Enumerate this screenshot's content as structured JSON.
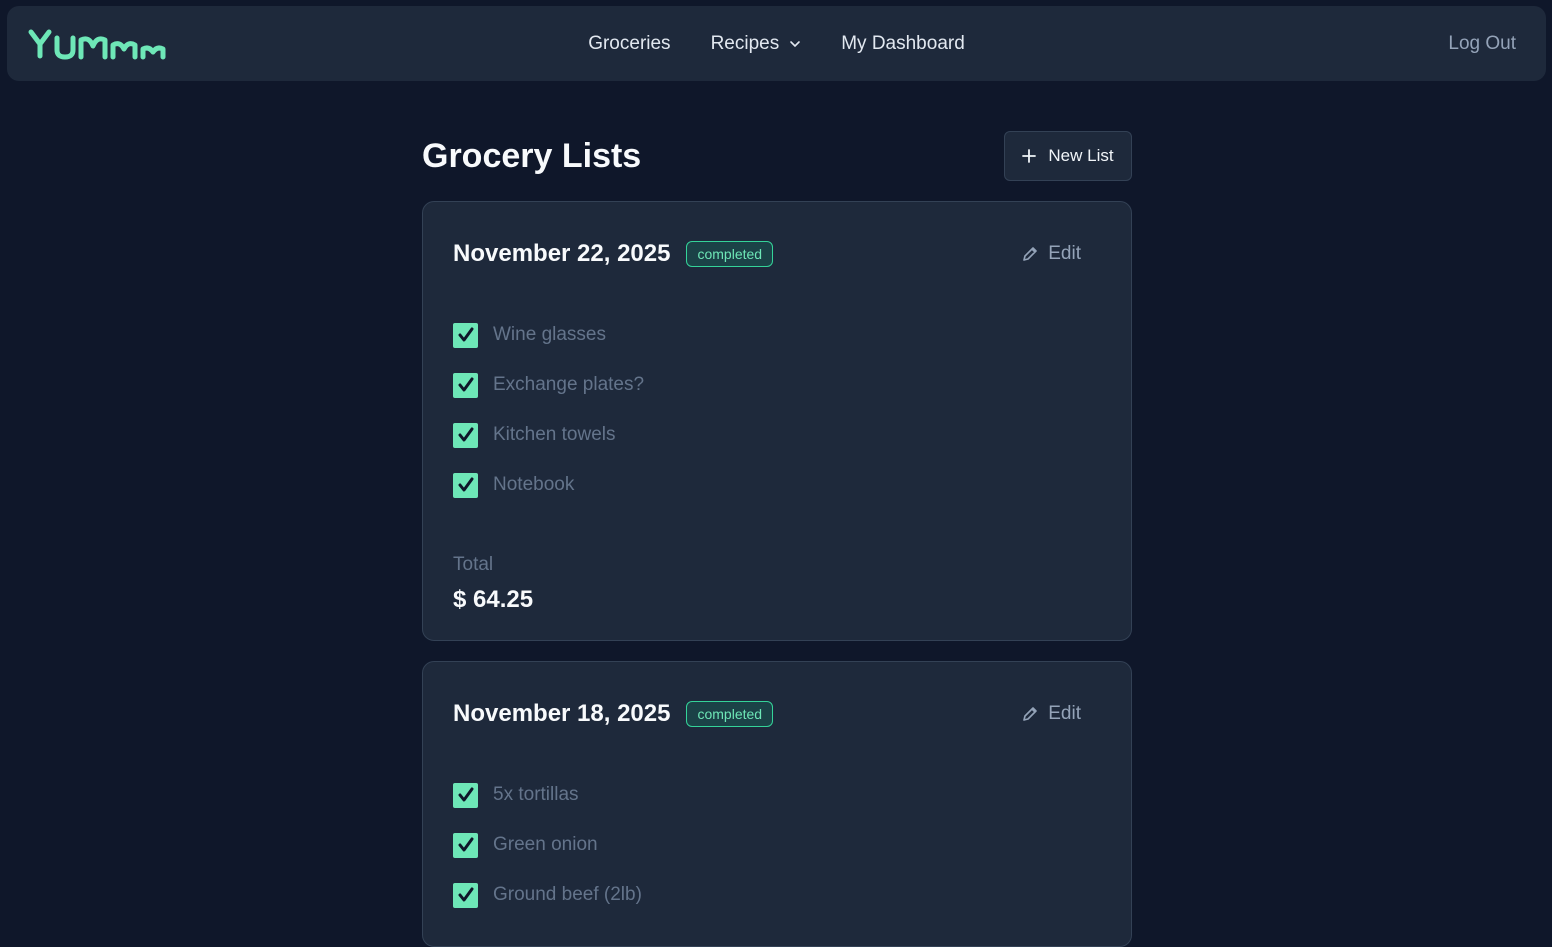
{
  "nav": {
    "logo_text": "YUMMM",
    "links": [
      {
        "label": "Groceries"
      },
      {
        "label": "Recipes"
      },
      {
        "label": "My Dashboard"
      }
    ],
    "logout": "Log Out"
  },
  "colors": {
    "accent": "#6ee7b7",
    "background": "#0f172a",
    "surface": "#1e293b"
  },
  "page": {
    "title": "Grocery Lists",
    "new_list_label": "New List"
  },
  "lists": [
    {
      "date": "November 22, 2025",
      "status": "completed",
      "edit_label": "Edit",
      "items": [
        {
          "label": "Wine glasses",
          "checked": true
        },
        {
          "label": "Exchange plates?",
          "checked": true
        },
        {
          "label": "Kitchen towels",
          "checked": true
        },
        {
          "label": "Notebook",
          "checked": true
        }
      ],
      "total_label": "Total",
      "total_value": "$ 64.25"
    },
    {
      "date": "November 18, 2025",
      "status": "completed",
      "edit_label": "Edit",
      "items": [
        {
          "label": "5x tortillas",
          "checked": true
        },
        {
          "label": "Green onion",
          "checked": true
        },
        {
          "label": "Ground beef (2lb)",
          "checked": true
        }
      ]
    }
  ]
}
